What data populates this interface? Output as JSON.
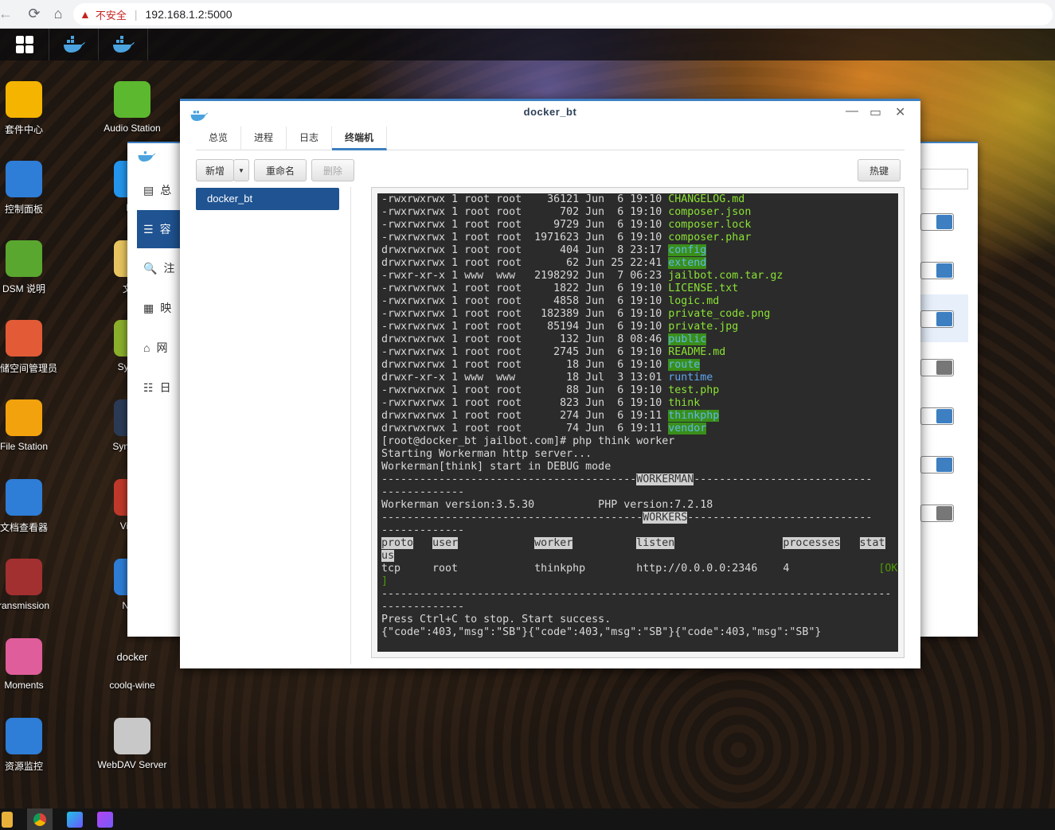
{
  "browser": {
    "back": "←",
    "reload": "⟳",
    "home": "⌂",
    "warning_icon": "▲",
    "security_label": "不安全",
    "separator": "|",
    "url": "192.168.1.2:5000"
  },
  "desktop_icons_left": [
    {
      "label": "套件中心",
      "icon": "package-center-icon",
      "color": "#f4b400"
    },
    {
      "label": "控制面板",
      "icon": "control-panel-icon",
      "color": "#2e7dd7"
    },
    {
      "label": "DSM 说明",
      "icon": "help-icon",
      "color": "#5aa72f"
    },
    {
      "label": "存储空间管理员",
      "icon": "storage-manager-icon",
      "color": "#e25b36"
    },
    {
      "label": "File Station",
      "icon": "file-station-icon",
      "color": "#f2a20c"
    },
    {
      "label": "文档查看器",
      "icon": "document-viewer-icon",
      "color": "#2e7dd7"
    },
    {
      "label": "ransmission",
      "icon": "transmission-icon",
      "color": "#a23030"
    },
    {
      "label": "Moments",
      "icon": "moments-icon",
      "color": "#e05d9b"
    },
    {
      "label": "资源监控",
      "icon": "resource-monitor-icon",
      "color": "#2e7dd7"
    }
  ],
  "desktop_icons_right": [
    {
      "label": "Audio Station",
      "icon": "audio-station-icon",
      "color": "#5cb82e"
    },
    {
      "label": "Do",
      "icon": "docker-icon",
      "color": "#2496ed"
    },
    {
      "label": "文本",
      "icon": "text-editor-icon",
      "color": "#e8c560"
    },
    {
      "label": "Synolo",
      "icon": "synology-app-icon",
      "color": "#8bb02c"
    },
    {
      "label": "Synology",
      "icon": "synology-drive-icon",
      "color": "#2b3b55"
    },
    {
      "label": "Video",
      "icon": "video-station-icon",
      "color": "#c0392b"
    },
    {
      "label": "Note",
      "icon": "note-station-icon",
      "color": "#2e7dd7"
    },
    {
      "label": "coolq-wine",
      "icon": "docker-icon",
      "color": "#2496ed"
    },
    {
      "label": "WebDAV Server",
      "icon": "webdav-icon",
      "color": "#c8c8c8"
    }
  ],
  "docker_caption": "docker",
  "back_window": {
    "items": [
      "总",
      "容",
      "注",
      "映",
      "网",
      "日"
    ]
  },
  "window": {
    "title": "docker_bt",
    "tabs": [
      "总览",
      "进程",
      "日志",
      "终端机"
    ],
    "active_tab": "终端机",
    "buttons": {
      "new": "新增",
      "rename": "重命名",
      "delete": "删除",
      "hotkeys": "热键"
    },
    "sessions": [
      "docker_bt"
    ]
  },
  "terminal": {
    "files": [
      {
        "perm": "-rwxrwxrwx",
        "n": "1",
        "user": "root",
        "group": "root",
        "size": "36121",
        "month": "Jun",
        "day": "6",
        "time": "19:10",
        "name": "CHANGELOG.md",
        "kind": "file"
      },
      {
        "perm": "-rwxrwxrwx",
        "n": "1",
        "user": "root",
        "group": "root",
        "size": "702",
        "month": "Jun",
        "day": "6",
        "time": "19:10",
        "name": "composer.json",
        "kind": "file"
      },
      {
        "perm": "-rwxrwxrwx",
        "n": "1",
        "user": "root",
        "group": "root",
        "size": "9729",
        "month": "Jun",
        "day": "6",
        "time": "19:10",
        "name": "composer.lock",
        "kind": "file"
      },
      {
        "perm": "-rwxrwxrwx",
        "n": "1",
        "user": "root",
        "group": "root",
        "size": "1971623",
        "month": "Jun",
        "day": "6",
        "time": "19:10",
        "name": "composer.phar",
        "kind": "file"
      },
      {
        "perm": "drwxrwxrwx",
        "n": "1",
        "user": "root",
        "group": "root",
        "size": "404",
        "month": "Jun",
        "day": "8",
        "time": "23:17",
        "name": "config",
        "kind": "dir"
      },
      {
        "perm": "drwxrwxrwx",
        "n": "1",
        "user": "root",
        "group": "root",
        "size": "62",
        "month": "Jun",
        "day": "25",
        "time": "22:41",
        "name": "extend",
        "kind": "dir"
      },
      {
        "perm": "-rwxr-xr-x",
        "n": "1",
        "user": "www",
        "group": "www",
        "size": "2198292",
        "month": "Jun",
        "day": "7",
        "time": "06:23",
        "name": "jailbot.com.tar.gz",
        "kind": "file"
      },
      {
        "perm": "-rwxrwxrwx",
        "n": "1",
        "user": "root",
        "group": "root",
        "size": "1822",
        "month": "Jun",
        "day": "6",
        "time": "19:10",
        "name": "LICENSE.txt",
        "kind": "file"
      },
      {
        "perm": "-rwxrwxrwx",
        "n": "1",
        "user": "root",
        "group": "root",
        "size": "4858",
        "month": "Jun",
        "day": "6",
        "time": "19:10",
        "name": "logic.md",
        "kind": "file"
      },
      {
        "perm": "-rwxrwxrwx",
        "n": "1",
        "user": "root",
        "group": "root",
        "size": "182389",
        "month": "Jun",
        "day": "6",
        "time": "19:10",
        "name": "private_code.png",
        "kind": "file"
      },
      {
        "perm": "-rwxrwxrwx",
        "n": "1",
        "user": "root",
        "group": "root",
        "size": "85194",
        "month": "Jun",
        "day": "6",
        "time": "19:10",
        "name": "private.jpg",
        "kind": "file"
      },
      {
        "perm": "drwxrwxrwx",
        "n": "1",
        "user": "root",
        "group": "root",
        "size": "132",
        "month": "Jun",
        "day": "8",
        "time": "08:46",
        "name": "public",
        "kind": "dir"
      },
      {
        "perm": "-rwxrwxrwx",
        "n": "1",
        "user": "root",
        "group": "root",
        "size": "2745",
        "month": "Jun",
        "day": "6",
        "time": "19:10",
        "name": "README.md",
        "kind": "file"
      },
      {
        "perm": "drwxrwxrwx",
        "n": "1",
        "user": "root",
        "group": "root",
        "size": "18",
        "month": "Jun",
        "day": "6",
        "time": "19:10",
        "name": "route",
        "kind": "dir"
      },
      {
        "perm": "drwxr-xr-x",
        "n": "1",
        "user": "www",
        "group": "www",
        "size": "18",
        "month": "Jul",
        "day": "3",
        "time": "13:01",
        "name": "runtime",
        "kind": "plaindir"
      },
      {
        "perm": "-rwxrwxrwx",
        "n": "1",
        "user": "root",
        "group": "root",
        "size": "88",
        "month": "Jun",
        "day": "6",
        "time": "19:10",
        "name": "test.php",
        "kind": "file"
      },
      {
        "perm": "-rwxrwxrwx",
        "n": "1",
        "user": "root",
        "group": "root",
        "size": "823",
        "month": "Jun",
        "day": "6",
        "time": "19:10",
        "name": "think",
        "kind": "file"
      },
      {
        "perm": "drwxrwxrwx",
        "n": "1",
        "user": "root",
        "group": "root",
        "size": "274",
        "month": "Jun",
        "day": "6",
        "time": "19:11",
        "name": "thinkphp",
        "kind": "dir"
      },
      {
        "perm": "drwxrwxrwx",
        "n": "1",
        "user": "root",
        "group": "root",
        "size": "74",
        "month": "Jun",
        "day": "6",
        "time": "19:11",
        "name": "vendor",
        "kind": "dir"
      }
    ],
    "prompt_line": "[root@docker_bt jailbot.com]# php think worker",
    "line_starting": "Starting Workerman http server...",
    "line_debug": "Workerman[think] start in DEBUG mode",
    "sep_workerman_label": "WORKERMAN",
    "wrap_dashes": "-------------",
    "version_left": "Workerman version:3.5.30",
    "version_right": "PHP version:7.2.18",
    "sep_workers_label": "WORKERS",
    "table_headers": [
      "proto",
      "user",
      "worker",
      "listen",
      "processes",
      "stat"
    ],
    "header_wrap": "us",
    "worker_row": {
      "proto": "tcp",
      "user": "root",
      "worker": "thinkphp",
      "listen": "http://0.0.0.0:2346",
      "processes": "4",
      "status": "[OK"
    },
    "status_wrap": "]",
    "line_press": "Press Ctrl+C to stop. Start success.",
    "line_json": "{\"code\":403,\"msg\":\"SB\"}{\"code\":403,\"msg\":\"SB\"}{\"code\":403,\"msg\":\"SB\"}"
  }
}
